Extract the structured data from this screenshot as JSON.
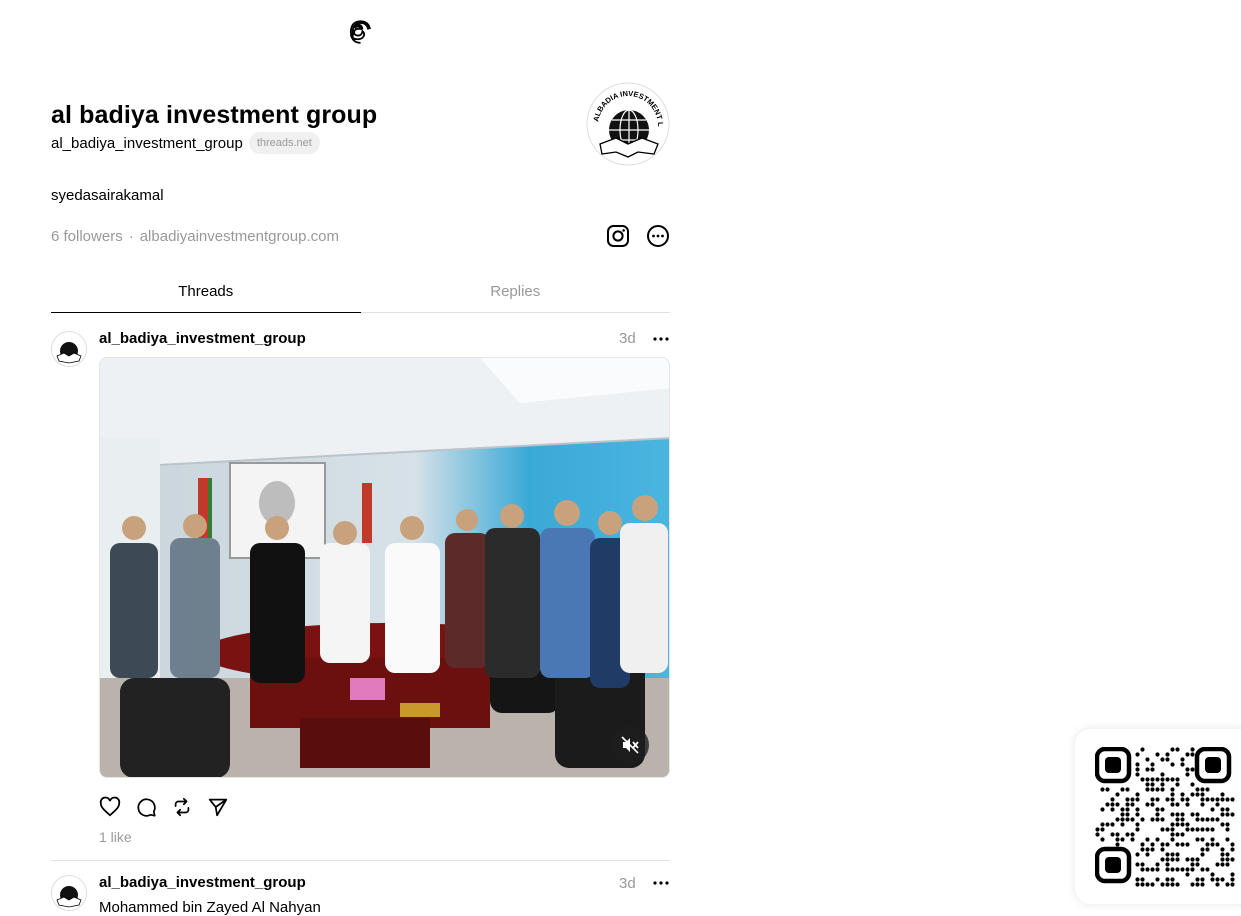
{
  "header": {
    "logo_icon": "threads-logo-icon"
  },
  "profile": {
    "name": "al badiya investment group",
    "handle": "al_badiya_investment_group",
    "domain_badge": "threads.net",
    "bio": "syedasairakamal",
    "followers": "6 followers",
    "separator": "·",
    "website": "albadiyainvestmentgroup.com",
    "avatar_text": "ALBADIA INVESTMENT L.L.C"
  },
  "tabs": [
    {
      "label": "Threads",
      "active": true
    },
    {
      "label": "Replies",
      "active": false
    }
  ],
  "posts": [
    {
      "username": "al_badiya_investment_group",
      "time": "3d",
      "likes": "1 like",
      "media": "group-photo-office",
      "media_muted": true
    },
    {
      "username": "al_badiya_investment_group",
      "time": "3d",
      "text": "Mohammed bin Zayed Al Nahyan"
    }
  ],
  "colors": {
    "muted_text": "#999999",
    "divider": "#e0e0e0"
  }
}
